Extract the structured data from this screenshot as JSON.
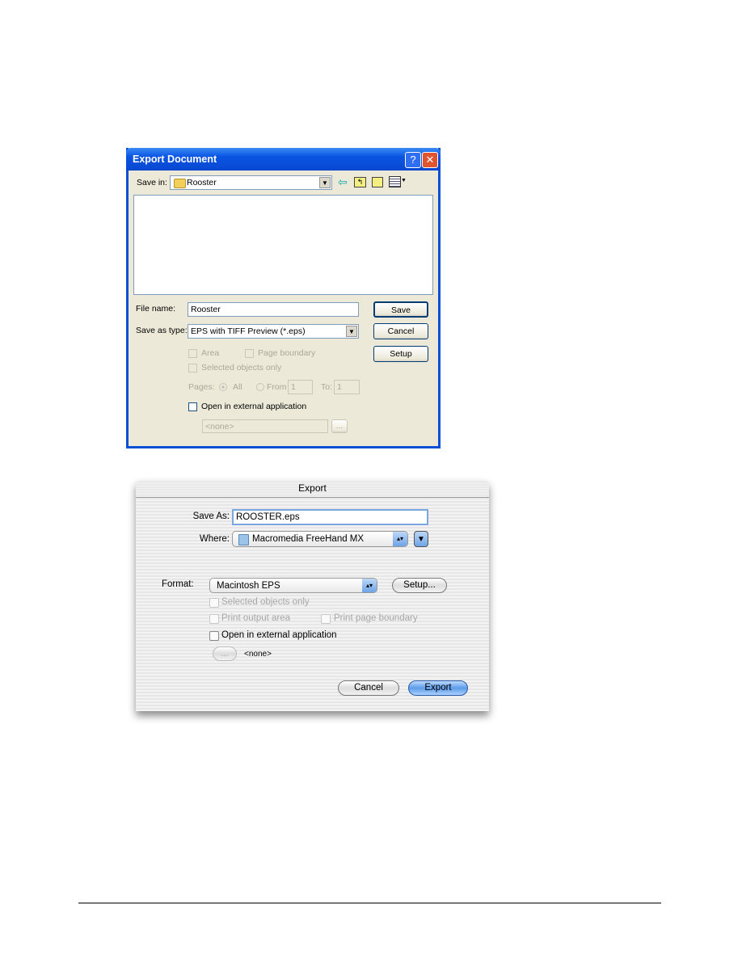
{
  "windows_dialog": {
    "title": "Export Document",
    "help_label": "?",
    "close_label": "✕",
    "save_in_label": "Save in:",
    "save_in_value": "Rooster",
    "toolbar_icons": [
      "back-icon",
      "up-folder-icon",
      "new-folder-icon",
      "view-menu-icon"
    ],
    "file_name_label": "File name:",
    "file_name_value": "Rooster",
    "save_as_type_label": "Save as type:",
    "save_as_type_value": "EPS with TIFF Preview (*.eps)",
    "save_button": "Save",
    "cancel_button": "Cancel",
    "setup_button": "Setup",
    "area_label": "Area",
    "page_boundary_label": "Page boundary",
    "selected_objects_label": "Selected objects only",
    "pages_label": "Pages:",
    "all_label": "All",
    "from_label": "From",
    "from_value": "1",
    "to_label": "To:",
    "to_value": "1",
    "open_external_label": "Open in external application",
    "app_value": "<none>",
    "browse_button": "..."
  },
  "mac_dialog": {
    "title": "Export",
    "save_as_label": "Save As:",
    "save_as_value": "ROOSTER.eps",
    "where_label": "Where:",
    "where_value": "Macromedia FreeHand MX",
    "format_label": "Format:",
    "format_value": "Macintosh EPS",
    "setup_button": "Setup...",
    "selected_objects_label": "Selected objects only",
    "print_output_label": "Print output area",
    "print_boundary_label": "Print page boundary",
    "open_external_label": "Open in external application",
    "browse_button": "...",
    "app_value": "<none>",
    "cancel_button": "Cancel",
    "export_button": "Export"
  }
}
